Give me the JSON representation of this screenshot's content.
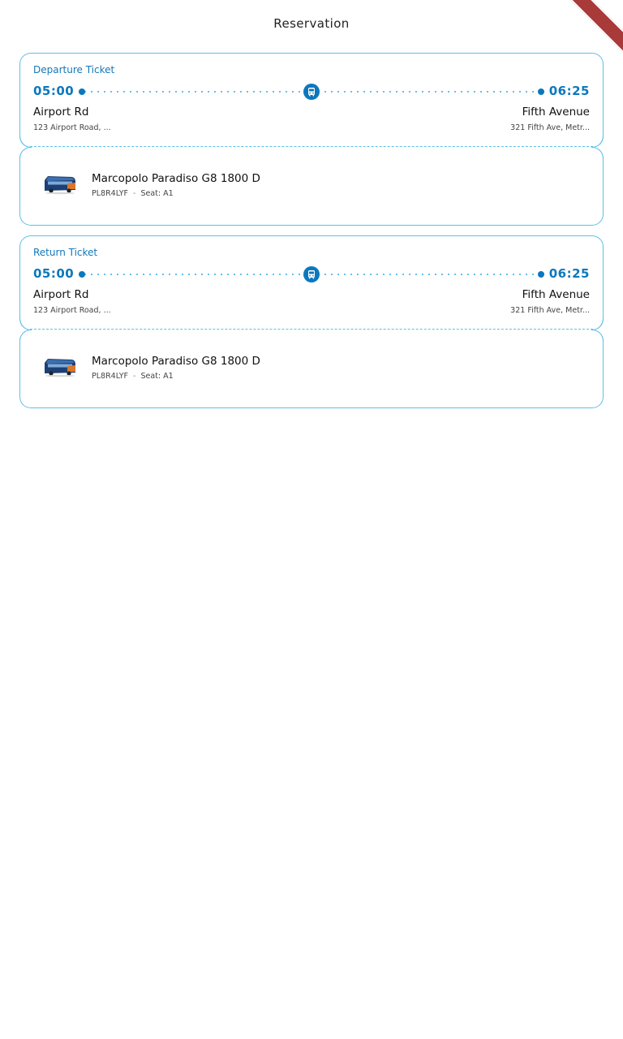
{
  "header": {
    "title": "Reservation"
  },
  "tickets": [
    {
      "label": "Departure Ticket",
      "departure_time": "05:00",
      "arrival_time": "06:25",
      "origin_name": "Airport Rd",
      "origin_address": "123 Airport Road, ...",
      "destination_name": "Fifth Avenue",
      "destination_address": "321 Fifth Ave, Metr...",
      "bus_model": "Marcopolo Paradiso G8 1800 D",
      "plate": "PL8R4LYF",
      "separator": "-",
      "seat": "Seat: A1"
    },
    {
      "label": "Return Ticket",
      "departure_time": "05:00",
      "arrival_time": "06:25",
      "origin_name": "Airport Rd",
      "origin_address": "123 Airport Road, ...",
      "destination_name": "Fifth Avenue",
      "destination_address": "321 Fifth Ave, Metr...",
      "bus_model": "Marcopolo Paradiso G8 1800 D",
      "plate": "PL8R4LYF",
      "separator": "-",
      "seat": "Seat: A1"
    }
  ],
  "icons": {
    "route": "bus-icon",
    "vehicle": "bus-photo"
  },
  "colors": {
    "accent": "#0b78bd",
    "border": "#5ec0e6",
    "debug_banner": "#a83a3a"
  }
}
